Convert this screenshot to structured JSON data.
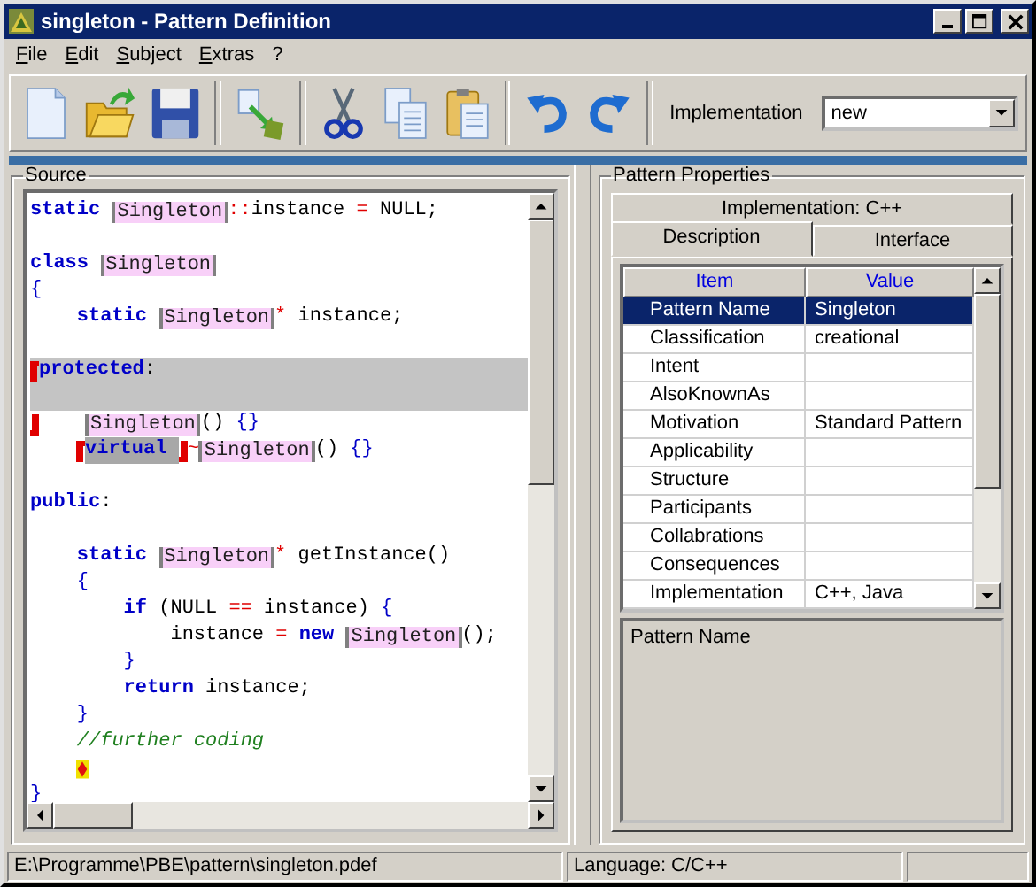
{
  "window": {
    "title": "singleton - Pattern Definition"
  },
  "menu": [
    "File",
    "Edit",
    "Subject",
    "Extras",
    "?"
  ],
  "toolbar": {
    "implementation_label": "Implementation",
    "implementation_value": "new"
  },
  "source": {
    "title": "Source",
    "lines": [
      {
        "highlighted": false,
        "tokens": [
          {
            "kind": "kw",
            "text": "static "
          },
          {
            "kind": "ref",
            "text": "Singleton"
          },
          {
            "kind": "op",
            "text": "::"
          },
          {
            "kind": "text",
            "text": "instance "
          },
          {
            "kind": "op",
            "text": "="
          },
          {
            "kind": "text",
            "text": " NULL;"
          }
        ]
      },
      {
        "highlighted": false
      },
      {
        "highlighted": false,
        "tokens": [
          {
            "kind": "kw",
            "text": "class "
          },
          {
            "kind": "ref",
            "text": "Singleton"
          }
        ]
      },
      {
        "highlighted": false,
        "tokens": [
          {
            "kind": "brace",
            "text": "{"
          }
        ]
      },
      {
        "highlighted": false,
        "tokens": [
          {
            "kind": "kw",
            "text": "    static "
          },
          {
            "kind": "ref",
            "text": "Singleton"
          },
          {
            "kind": "op",
            "text": "*"
          },
          {
            "kind": "text",
            "text": " instance;"
          }
        ]
      },
      {
        "highlighted": false
      },
      {
        "highlighted": true,
        "tokens": [
          {
            "kind": "mark-open"
          },
          {
            "kind": "kw",
            "text": "protected"
          },
          {
            "kind": "text",
            "text": ":"
          }
        ]
      },
      {
        "highlighted": true
      },
      {
        "highlighted": false,
        "tokens": [
          {
            "kind": "mark-close"
          },
          {
            "kind": "ref",
            "text": "Singleton"
          },
          {
            "kind": "text",
            "text": "() "
          },
          {
            "kind": "brace",
            "text": "{}"
          }
        ]
      },
      {
        "highlighted": false,
        "tokens": [
          {
            "kind": "mark-open"
          },
          {
            "kind": "selected-kw",
            "text": "virtual "
          },
          {
            "kind": "mark-close"
          },
          {
            "kind": "op",
            "text": "~"
          },
          {
            "kind": "ref",
            "text": "Singleton"
          },
          {
            "kind": "text",
            "text": "() "
          },
          {
            "kind": "brace",
            "text": "{}"
          }
        ]
      },
      {
        "highlighted": false
      },
      {
        "highlighted": false,
        "tokens": [
          {
            "kind": "kw",
            "text": "public"
          },
          {
            "kind": "text",
            "text": ":"
          }
        ]
      },
      {
        "highlighted": false
      },
      {
        "highlighted": false,
        "tokens": [
          {
            "kind": "kw",
            "text": "    static "
          },
          {
            "kind": "ref",
            "text": "Singleton"
          },
          {
            "kind": "op",
            "text": "*"
          },
          {
            "kind": "text",
            "text": " getInstance()"
          }
        ]
      },
      {
        "highlighted": false,
        "tokens": [
          {
            "kind": "brace",
            "text": "    {"
          }
        ]
      },
      {
        "highlighted": false,
        "tokens": [
          {
            "kind": "kw",
            "text": "        if"
          },
          {
            "kind": "text",
            "text": " (NULL "
          },
          {
            "kind": "op",
            "text": "=="
          },
          {
            "kind": "text",
            "text": " instance) "
          },
          {
            "kind": "brace",
            "text": "{"
          }
        ]
      },
      {
        "highlighted": false,
        "tokens": [
          {
            "kind": "text",
            "text": "            instance "
          },
          {
            "kind": "op",
            "text": "="
          },
          {
            "kind": "kw",
            "text": " new "
          },
          {
            "kind": "ref",
            "text": "Singleton"
          },
          {
            "kind": "text",
            "text": "();"
          }
        ]
      },
      {
        "highlighted": false,
        "tokens": [
          {
            "kind": "brace",
            "text": "        }"
          }
        ]
      },
      {
        "highlighted": false,
        "tokens": [
          {
            "kind": "kw",
            "text": "        return"
          },
          {
            "kind": "text",
            "text": " instance;"
          }
        ]
      },
      {
        "highlighted": false,
        "tokens": [
          {
            "kind": "brace",
            "text": "    }"
          }
        ]
      },
      {
        "highlighted": false,
        "tokens": [
          {
            "kind": "comment",
            "text": "    //further coding"
          }
        ]
      },
      {
        "highlighted": false,
        "tokens": [
          {
            "kind": "caret"
          }
        ]
      },
      {
        "highlighted": false,
        "tokens": [
          {
            "kind": "brace",
            "text": "}"
          }
        ]
      }
    ]
  },
  "properties": {
    "title": "Pattern Properties",
    "tab_rows": [
      [
        {
          "label": "Implementation: C++",
          "selected": false
        }
      ],
      [
        {
          "label": "Description",
          "selected": true
        },
        {
          "label": "Interface",
          "selected": false
        }
      ]
    ],
    "table": {
      "columns": [
        "Item",
        "Value"
      ],
      "rows": [
        {
          "item": "Pattern Name",
          "value": "Singleton",
          "selected": true
        },
        {
          "item": "Classification",
          "value": "creational",
          "selected": false
        },
        {
          "item": "Intent",
          "selected": false
        },
        {
          "item": "AlsoKnownAs",
          "selected": false
        },
        {
          "item": "Motivation",
          "value": "Standard Pattern",
          "selected": false
        },
        {
          "item": "Applicability",
          "selected": false
        },
        {
          "item": "Structure",
          "selected": false
        },
        {
          "item": "Participants",
          "selected": false
        },
        {
          "item": "Collabrations",
          "selected": false
        },
        {
          "item": "Consequences",
          "selected": false
        },
        {
          "item": "Implementation",
          "value": "C++, Java",
          "selected": false
        }
      ]
    },
    "description": "Pattern Name"
  },
  "status_bar": {
    "path": "E:\\Programme\\PBE\\pattern\\singleton.pdef",
    "language": "Language: C/C++"
  }
}
